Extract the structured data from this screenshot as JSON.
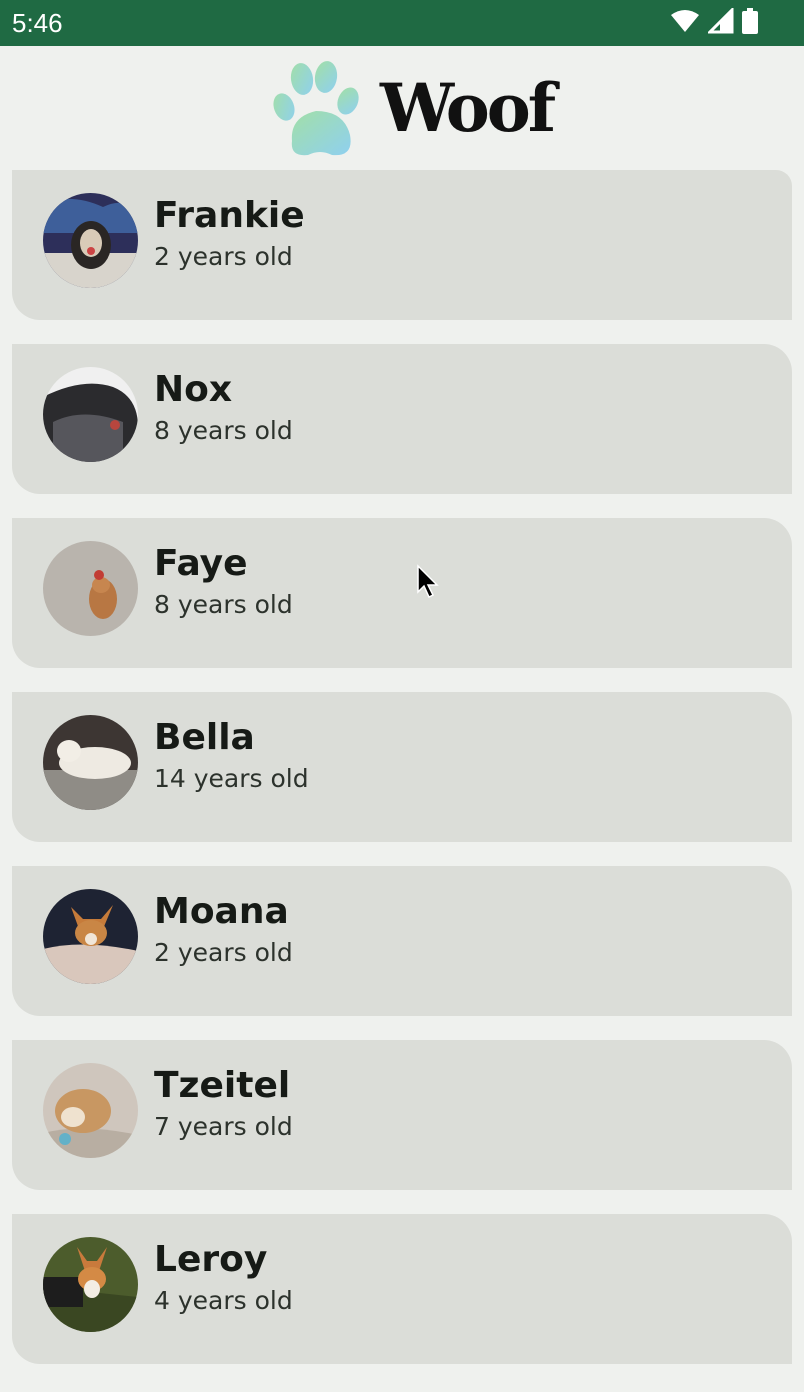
{
  "status_bar": {
    "time": "5:46",
    "background_color": "#1f6a43",
    "icons": [
      "wifi-icon",
      "cellular-signal-icon",
      "battery-icon"
    ]
  },
  "app_bar": {
    "title": "Woof",
    "logo_icon": "paw-icon"
  },
  "colors": {
    "background": "#eff1ee",
    "card": "#dbddd8",
    "paw_gradient_start": "#a2dfa7",
    "paw_gradient_end": "#8fd0ef"
  },
  "dogs": [
    {
      "name": "Frankie",
      "age": "2 years old"
    },
    {
      "name": "Nox",
      "age": "8 years old"
    },
    {
      "name": "Faye",
      "age": "8 years old"
    },
    {
      "name": "Bella",
      "age": "14 years old"
    },
    {
      "name": "Moana",
      "age": "2 years old"
    },
    {
      "name": "Tzeitel",
      "age": "7 years old"
    },
    {
      "name": "Leroy",
      "age": "4 years old"
    }
  ]
}
